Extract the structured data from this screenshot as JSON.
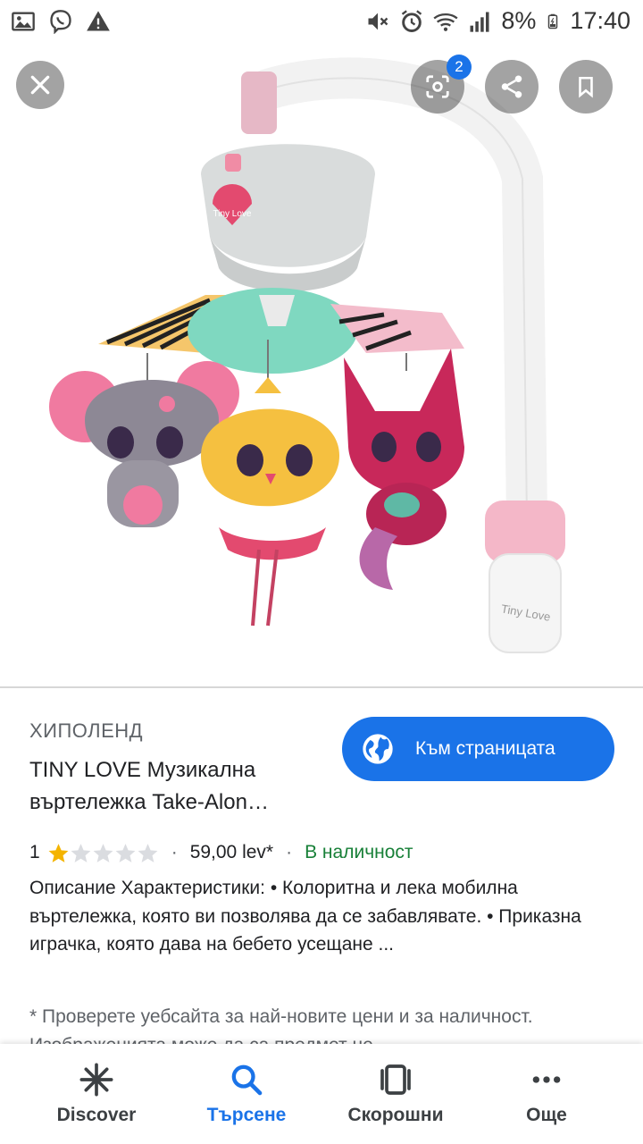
{
  "status_bar": {
    "left_icons": [
      "image-icon",
      "viber-icon",
      "warning-icon"
    ],
    "right_icons": [
      "mute-icon",
      "alarm-icon",
      "wifi-icon",
      "signal-icon",
      "battery-icon"
    ],
    "battery": "8%",
    "time": "17:40"
  },
  "image_viewer": {
    "lens_badge_count": "2",
    "toy_brand_label": "Tiny Love"
  },
  "result": {
    "source": "ХИПОЛЕНД",
    "title": "TINY LOVE Музикална въртележка Take-Alon…",
    "visit_button_label": "Към страницата",
    "rating_value": "1",
    "rating_stars_filled": 1,
    "rating_stars_total": 5,
    "separator": "·",
    "price": "59,00 lev*",
    "availability": "В наличност",
    "description": "Описание Характеристики: • Колоритна и лека мобилна въртележка, която ви позволява да се забавлявате. • Приказна играчка, която дава на бебето усещане ...",
    "note": "* Проверете уебсайта за най-новите цени и за наличност. Изображенията може да са предмет не"
  },
  "bottom_nav": {
    "items": [
      {
        "label": "Discover",
        "icon": "asterisk-icon",
        "active": false
      },
      {
        "label": "Търсене",
        "icon": "search-icon",
        "active": true
      },
      {
        "label": "Скорошни",
        "icon": "tabs-icon",
        "active": false
      },
      {
        "label": "Още",
        "icon": "more-icon",
        "active": false
      }
    ]
  },
  "colors": {
    "accent": "#1a73e8",
    "in_stock": "#188038",
    "star_filled": "#f4b400",
    "star_empty": "#dadce0"
  }
}
